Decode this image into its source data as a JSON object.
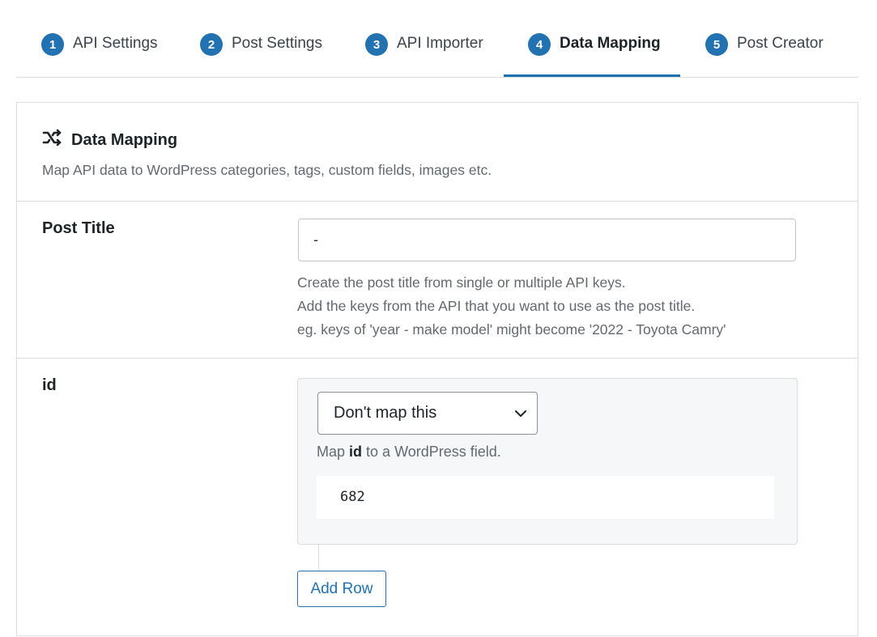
{
  "tabs": [
    {
      "num": "1",
      "label": "API Settings"
    },
    {
      "num": "2",
      "label": "Post Settings"
    },
    {
      "num": "3",
      "label": "API Importer"
    },
    {
      "num": "4",
      "label": "Data Mapping",
      "active": true
    },
    {
      "num": "5",
      "label": "Post Creator"
    }
  ],
  "section": {
    "icon": "shuffle-icon",
    "title": "Data Mapping",
    "description": "Map API data to WordPress categories, tags, custom fields, images etc."
  },
  "post_title": {
    "label": "Post Title",
    "value": "-",
    "help": [
      "Create the post title from single or multiple API keys.",
      "Add the keys from the API that you want to use as the post title.",
      "eg. keys of 'year - make model' might become '2022 - Toyota Camry'"
    ]
  },
  "id_row": {
    "label": "id",
    "select_value": "Don't map this",
    "help_prefix": "Map",
    "help_key": "id",
    "help_suffix": "to a WordPress field.",
    "sample_value": "682",
    "add_row_label": "Add Row"
  },
  "colors": {
    "accent": "#2271b1",
    "border": "#dcdcde",
    "muted": "#646970"
  }
}
